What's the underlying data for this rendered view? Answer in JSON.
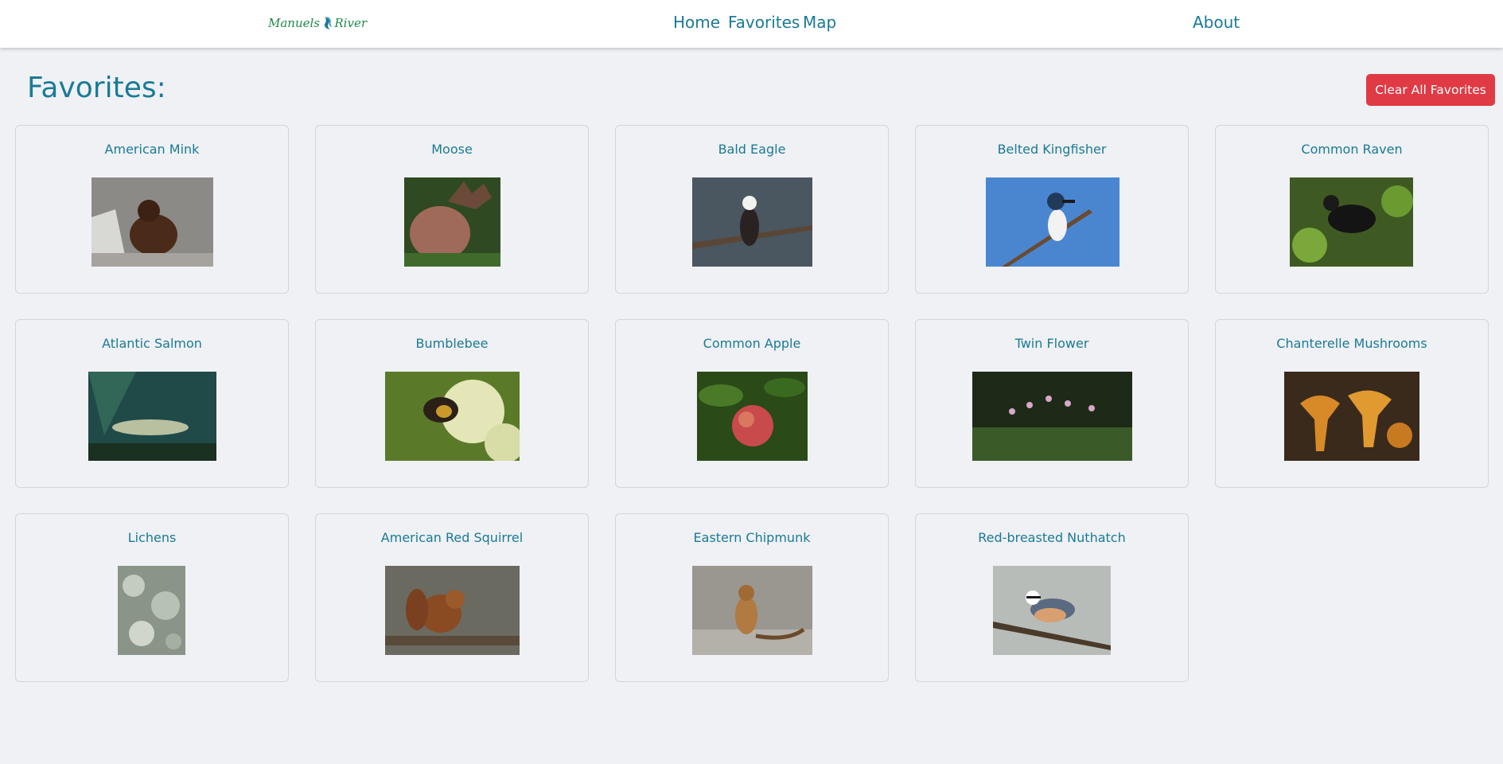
{
  "nav": {
    "logo_left": "Manuels",
    "logo_right": "River",
    "home": "Home",
    "favorites": "Favorites",
    "map": "Map",
    "about": "About"
  },
  "page": {
    "title": "Favorites:",
    "clear_button": "Clear All Favorites"
  },
  "colors": {
    "link": "#1a7a96",
    "danger": "#e03a45",
    "background": "#eff1f5",
    "logo_green": "#1f8a4c",
    "logo_teal": "#1a7a96"
  },
  "favorites": [
    {
      "name": "American Mink",
      "image": "mink-photo"
    },
    {
      "name": "Moose",
      "image": "moose-photo"
    },
    {
      "name": "Bald Eagle",
      "image": "bald-eagle-photo"
    },
    {
      "name": "Belted Kingfisher",
      "image": "kingfisher-photo"
    },
    {
      "name": "Common Raven",
      "image": "raven-photo"
    },
    {
      "name": "Atlantic Salmon",
      "image": "salmon-photo"
    },
    {
      "name": "Bumblebee",
      "image": "bumblebee-photo"
    },
    {
      "name": "Common Apple",
      "image": "apple-photo"
    },
    {
      "name": "Twin Flower",
      "image": "twin-flower-photo"
    },
    {
      "name": "Chanterelle Mushrooms",
      "image": "chanterelle-photo"
    },
    {
      "name": "Lichens",
      "image": "lichens-photo"
    },
    {
      "name": "American Red Squirrel",
      "image": "red-squirrel-photo"
    },
    {
      "name": "Eastern Chipmunk",
      "image": "chipmunk-photo"
    },
    {
      "name": "Red-breasted Nuthatch",
      "image": "nuthatch-photo"
    }
  ]
}
